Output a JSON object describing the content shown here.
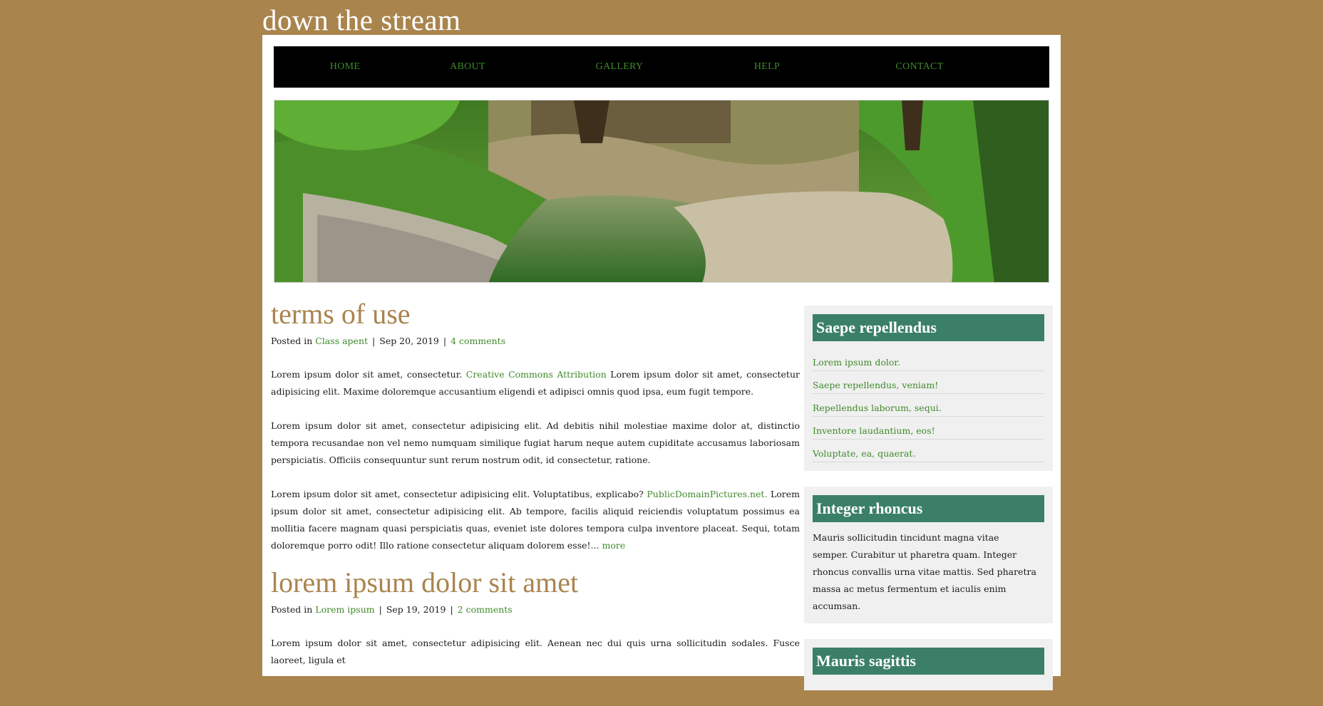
{
  "site": {
    "title": "down the stream"
  },
  "nav": {
    "items": [
      "HOME",
      "ABOUT",
      "GALLERY",
      "HELP",
      "CONTACT"
    ]
  },
  "posts": [
    {
      "title": "terms of use",
      "meta": {
        "posted_in": "Posted in",
        "category": "Class apent",
        "date": "Sep 20, 2019",
        "comments": "4 comments"
      },
      "p1_a": "Lorem ipsum dolor sit amet, consectetur. ",
      "p1_link": "Creative Commons Attribution",
      "p1_b": " Lorem ipsum dolor sit amet, consectetur adipisicing elit. Maxime doloremque accusantium eligendi et adipisci omnis quod ipsa, eum fugit tempore.",
      "p2": "Lorem ipsum dolor sit amet, consectetur adipisicing elit. Ad debitis nihil molestiae maxime dolor at, distinctio tempora recusandae non vel nemo numquam similique fugiat harum neque autem cupiditate accusamus laboriosam perspiciatis. Officiis consequuntur sunt rerum nostrum odit, id consectetur, ratione.",
      "p3_a": "Lorem ipsum dolor sit amet, consectetur adipisicing elit. Voluptatibus, explicabo? ",
      "p3_link": "PublicDomainPictures.net.",
      "p3_b": " Lorem ipsum dolor sit amet, consectetur adipisicing elit. Ab tempore, facilis aliquid reiciendis voluptatum possimus ea mollitia facere magnam quasi perspiciatis quas, eveniet iste dolores tempora culpa inventore placeat. Sequi, totam doloremque porro odit! Illo ratione consectetur aliquam dolorem esse!...",
      "more": "more"
    },
    {
      "title": "lorem ipsum dolor sit amet",
      "meta": {
        "posted_in": "Posted in",
        "category": "Lorem ipsum",
        "date": "Sep 19, 2019",
        "comments": "2 comments"
      },
      "p1": "Lorem ipsum dolor sit amet, consectetur adipisicing elit. Aenean nec dui quis urna sollicitudin sodales. Fusce laoreet, ligula et"
    }
  ],
  "sidebar": {
    "w1": {
      "title": "Saepe repellendus",
      "links": [
        "Lorem ipsum dolor.",
        "Saepe repellendus, veniam!",
        "Repellendus laborum, sequi.",
        "Inventore laudantium, eos!",
        "Voluptate, ea, quaerat."
      ]
    },
    "w2": {
      "title": "Integer rhoncus",
      "text": "Mauris sollicitudin tincidunt magna vitae semper. Curabitur ut pharetra quam. Integer rhoncus convallis urna vitae mattis. Sed pharetra massa ac metus fermentum et iaculis enim accumsan."
    },
    "w3": {
      "title": "Mauris sagittis"
    }
  },
  "colors": {
    "background": "#a9844d",
    "link": "#3f8a2a",
    "widget_header": "#3b7f69",
    "title": "#a9844d"
  }
}
